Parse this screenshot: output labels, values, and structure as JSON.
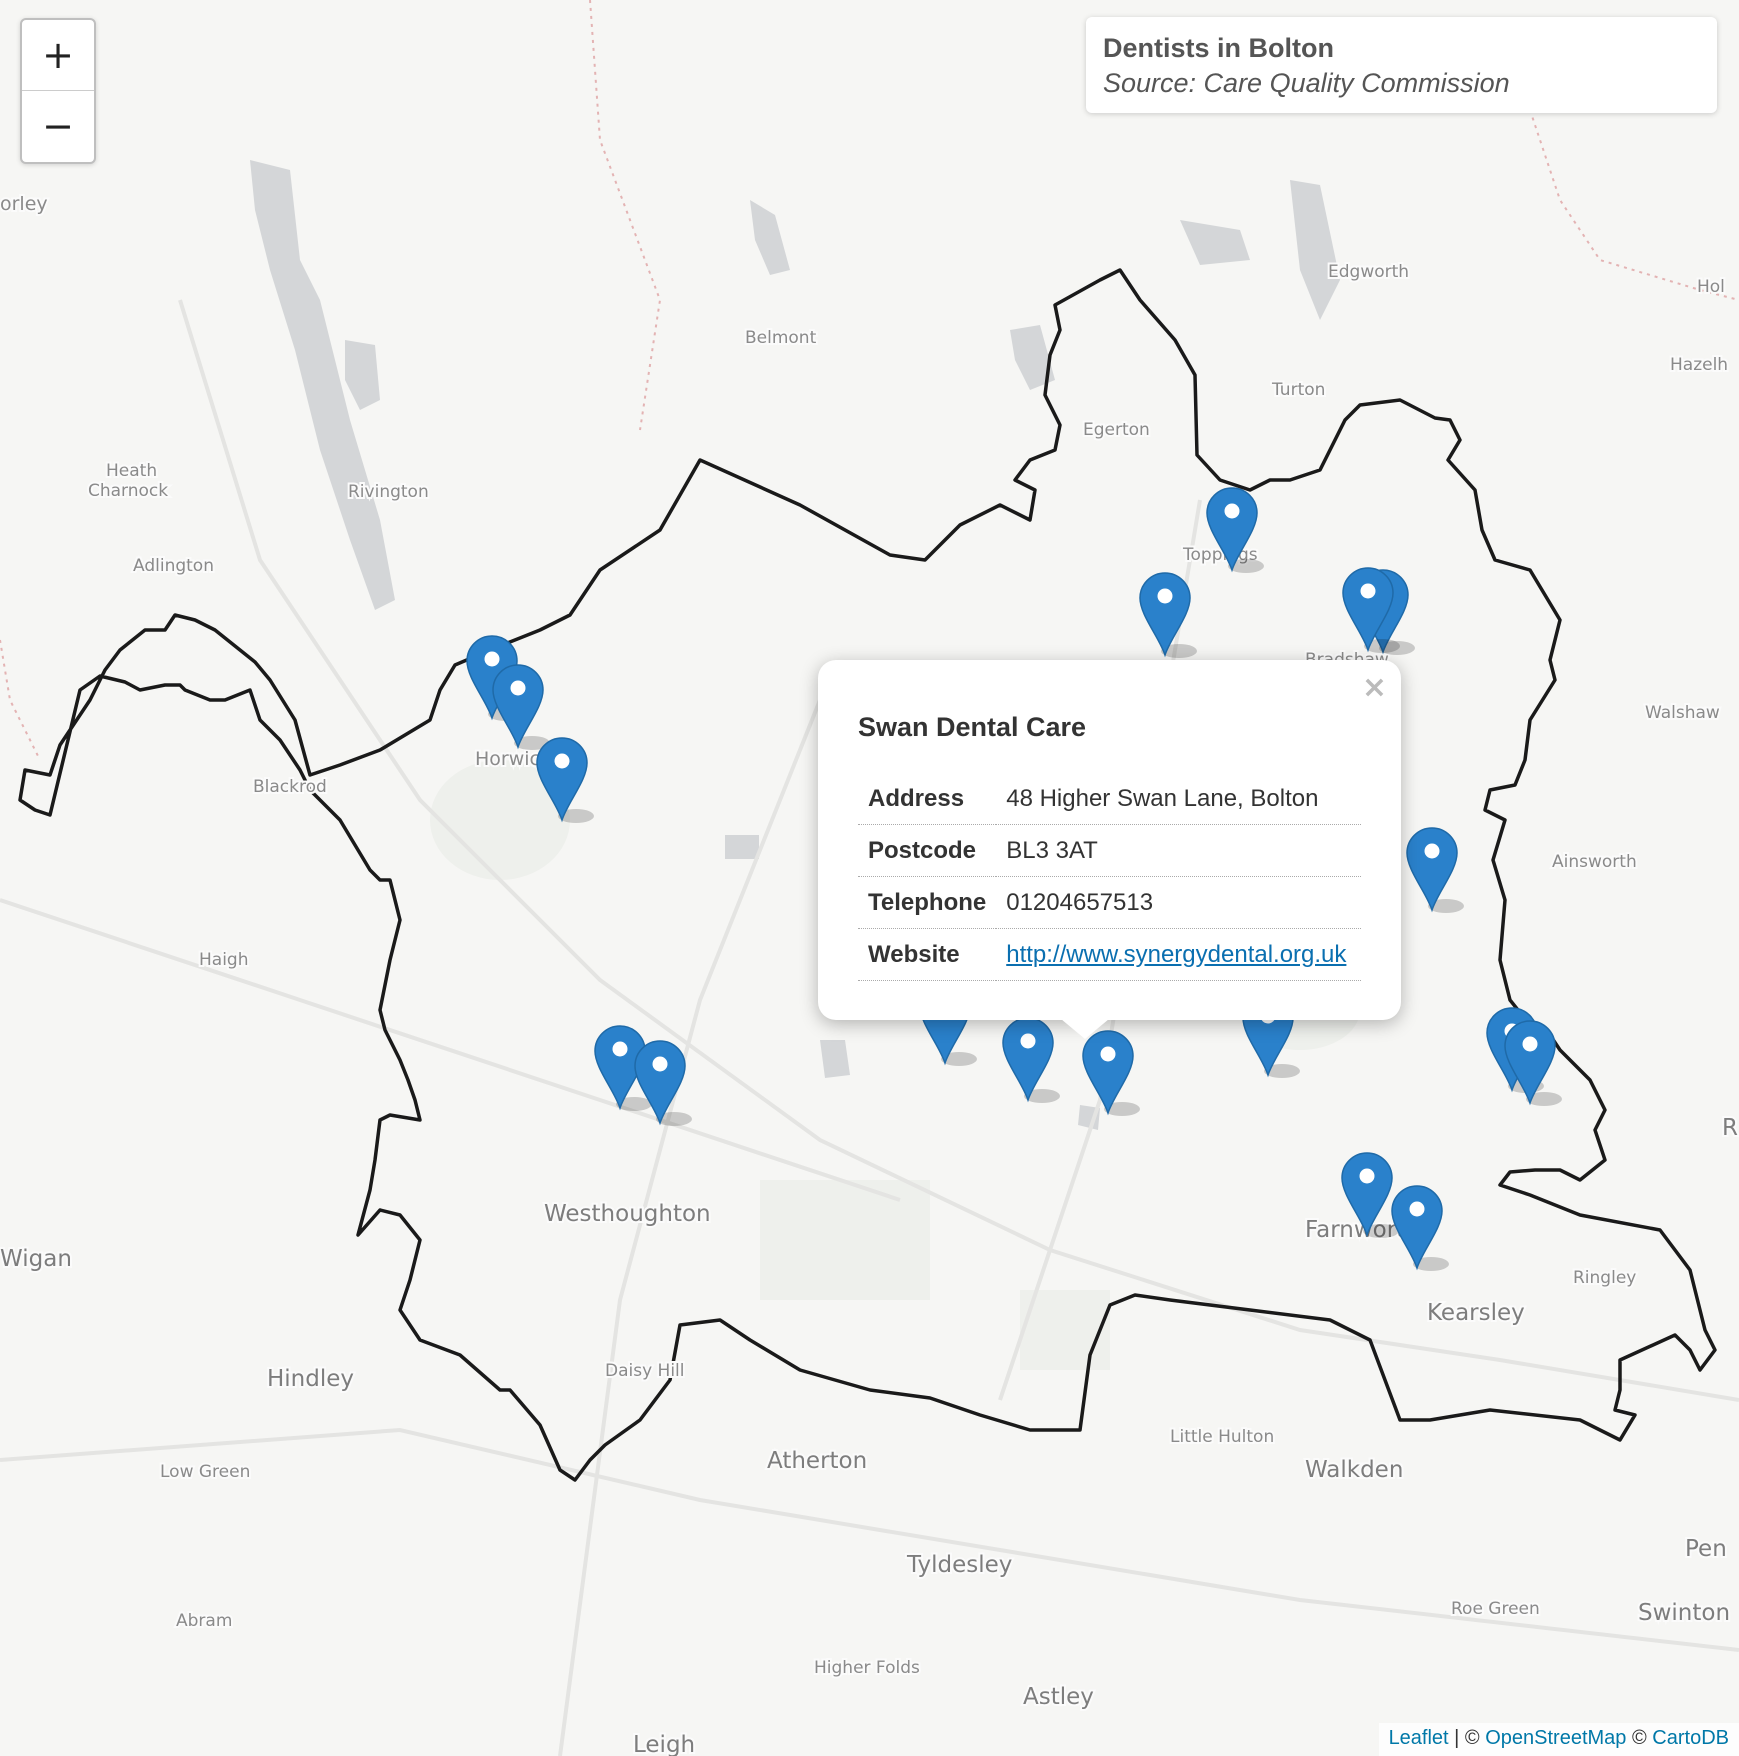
{
  "title_box": {
    "title": "Dentists in Bolton",
    "source": "Source: Care Quality Commission"
  },
  "zoom": {
    "in_label": "+",
    "out_label": "−"
  },
  "place_labels": {
    "chorley": "orley",
    "edgworth": "Edgworth",
    "belmont": "Belmont",
    "turton": "Turton",
    "egerton": "Egerton",
    "heath_charnock_1": "Heath",
    "heath_charnock_2": "Charnock",
    "rivington": "Rivington",
    "adlington": "Adlington",
    "toppings": "Toppings",
    "bradshaw": "Bradshaw",
    "holcombe": "Hol",
    "hazelhurst": "Hazelh",
    "walshaw": "Walshaw",
    "horwich": "Horwich",
    "blackrod": "Blackrod",
    "ainsworth": "Ainsworth",
    "haigh": "Haigh",
    "westhoughton": "Westhoughton",
    "wigan": "Wigan",
    "farnworth": "Farnworth",
    "ringley": "Ringley",
    "kearsley": "Kearsley",
    "radcliffe": "R",
    "hindley": "Hindley",
    "daisy_hill": "Daisy Hill",
    "little_hulton": "Little Hulton",
    "atherton": "Atherton",
    "walkden": "Walkden",
    "low_green": "Low Green",
    "tyldesley": "Tyldesley",
    "pendlebury": "Pen",
    "abram": "Abram",
    "roe_green": "Roe Green",
    "swinton": "Swinton",
    "higher_folds": "Higher Folds",
    "astley": "Astley",
    "leigh": "Leigh"
  },
  "markers": [
    {
      "name": "marker-horwich-1"
    },
    {
      "name": "marker-horwich-2"
    },
    {
      "name": "marker-horwich-3"
    },
    {
      "name": "marker-toppings"
    },
    {
      "name": "marker-astley-bridge"
    },
    {
      "name": "marker-bradshaw-1"
    },
    {
      "name": "marker-bradshaw-2"
    },
    {
      "name": "marker-breightmet"
    },
    {
      "name": "marker-westhoughton-1"
    },
    {
      "name": "marker-westhoughton-2"
    },
    {
      "name": "marker-central-1"
    },
    {
      "name": "marker-central-2"
    },
    {
      "name": "marker-swan-dental-care"
    },
    {
      "name": "marker-central-3"
    },
    {
      "name": "marker-central-4"
    },
    {
      "name": "marker-little-lever-1"
    },
    {
      "name": "marker-little-lever-2"
    },
    {
      "name": "marker-farnworth-1"
    },
    {
      "name": "marker-farnworth-2"
    }
  ],
  "popup": {
    "close": "×",
    "name": "Swan Dental Care",
    "rows": [
      {
        "key": "Address",
        "value": "48 Higher Swan Lane, Bolton"
      },
      {
        "key": "Postcode",
        "value": "BL3 3AT"
      },
      {
        "key": "Telephone",
        "value": "01204657513"
      }
    ],
    "website_key": "Website",
    "website": "http://www.synergydental.org.uk"
  },
  "attribution": {
    "leaflet": "Leaflet",
    "sep1": " | © ",
    "osm": "OpenStreetMap",
    "sep2": " © ",
    "carto": "CartoDB"
  },
  "colors": {
    "boundary": "#1a1a1a",
    "marker": "#2a81cb",
    "water": "#d4d6d8",
    "background": "#f6f6f4"
  }
}
